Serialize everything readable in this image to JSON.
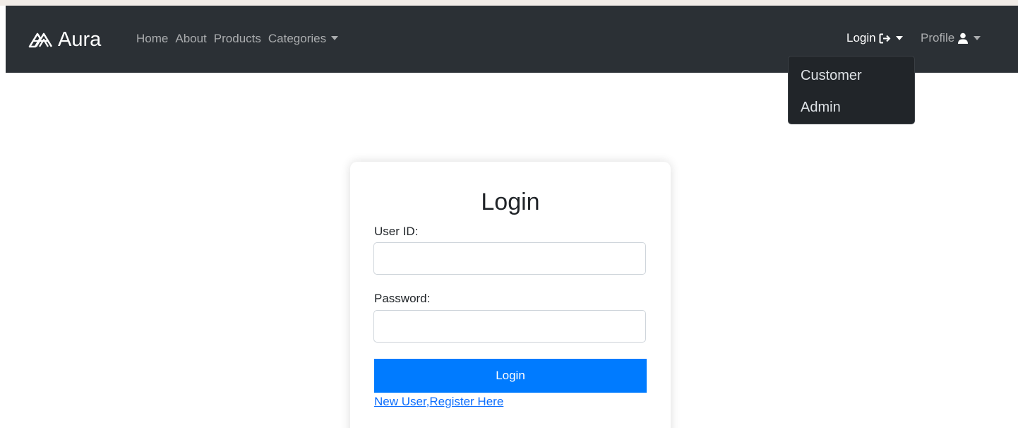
{
  "brand": {
    "name": "Aura",
    "icon": "aura-logo-icon"
  },
  "nav": {
    "links": [
      "Home",
      "About",
      "Products",
      "Categories"
    ],
    "login_label": "Login",
    "profile_label": "Profile"
  },
  "login_dropdown": {
    "items": [
      "Customer",
      "Admin"
    ]
  },
  "login_form": {
    "title": "Login",
    "user_id_label": "User ID:",
    "user_id_value": "",
    "password_label": "Password:",
    "password_value": "",
    "submit_label": "Login",
    "register_link": "New User,Register Here"
  },
  "colors": {
    "navbar": "#2b3035",
    "dropdown": "#212529",
    "primary_button": "#007bff",
    "link": "#0d6efd"
  }
}
